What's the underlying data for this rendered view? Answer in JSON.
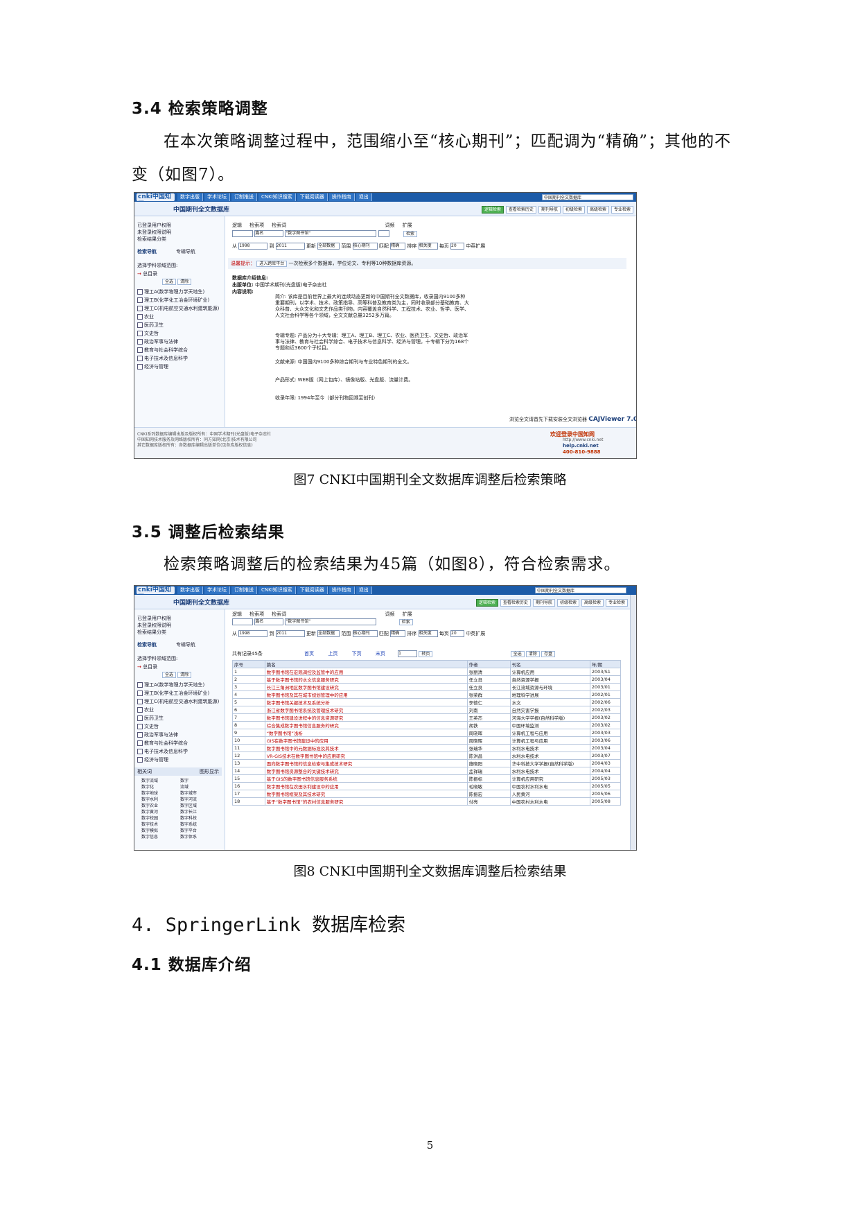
{
  "section_3_4": {
    "heading": "3.4 检索策略调整",
    "paragraph": "在本次策略调整过程中，范围缩小至“核心期刊”；匹配调为“精确”；其他的不变（如图7）。"
  },
  "figure7": {
    "caption": "图7 CNKI中国期刊全文数据库调整后检索策略",
    "logo": "cnki中国知网",
    "nav_tabs": [
      "数字出版",
      "学术论坛",
      "学术论坛",
      "订制推送",
      "CNKI知识搜索",
      "下载阅读器",
      "操作指南",
      "退出"
    ],
    "db_select": "中国期刊全文数据库",
    "db_title": "中国期刊全文数据库",
    "tools": [
      "逻辑检索",
      "查看检索历史",
      "期刊导航",
      "初级检索",
      "高级检索",
      "专业检索"
    ],
    "left_items": [
      "已登录用户权限",
      "未登录权限说明",
      "检索结果分类",
      "检索导航",
      "专辑导航",
      "选择学科领域范围:",
      "总目录",
      "全选",
      "清除",
      "理工A(数学物理力学天地生)",
      "理工B(化学化工冶金环境矿业)",
      "理工C(机电航空交通水利建筑能源)",
      "农业",
      "医药卫生",
      "文史哲",
      "政治军事与法律",
      "教育与社会科学综合",
      "电子技术及信息科学",
      "经济与管理"
    ],
    "fields_header": [
      "逻辑",
      "检索项",
      "检索词",
      "词频",
      "扩展"
    ],
    "field_values": [
      "篇名",
      "\"数字图书馆\"",
      "检索"
    ],
    "range_row": [
      "从",
      "1998",
      "到",
      "2011",
      "更新",
      "全部数据",
      "范围",
      "核心期刊",
      "匹配",
      "精确",
      "排序",
      "相关度",
      "每页",
      "20",
      "中英扩展"
    ],
    "hint_label": "温馨提示：",
    "hint_button": "进入跨库平台",
    "hint_text": "一次检索多个数据库，学位论文、专利等10种数据库资源。",
    "intro_title": "数据库介绍信息:",
    "publisher_label": "出版单位:",
    "publisher": "中国学术期刊(光盘版)电子杂志社",
    "content_label": "内容说明:",
    "desc_1_label": "简介:",
    "desc_1": "该库是目前世界上最大的连续动态更新的中国期刊全文数据库，收录国内9100多种重要期刊，以学术、技术、政策指导、高等科普及教育类为主，同时收录部分基础教育、大众科普、大众文化和文艺作品类刊物，内容覆盖自然科学、工程技术、农业、哲学、医学、人文社会科学等各个领域，全文文献总量3252多万篇。",
    "desc_2_label": "专辑专题:",
    "desc_2": "产品分为十大专辑：理工A、理工B、理工C、农业、医药卫生、文史哲、政治军事与法律、教育与社会科学综合、电子技术与信息科学、经济与管理。十专辑下分为168个专题和近3600个子栏目。",
    "desc_3_label": "文献来源:",
    "desc_3": "中国国内9100多种综合期刊与专业特色期刊的全文。",
    "desc_4_label": "产品形式:",
    "desc_4": "WEB版（网上包库）、镜像站版、光盘版、流量计费。",
    "desc_5_label": "收录年限:",
    "desc_5": "1994年至今（部分刊物回溯至创刊）",
    "cajviewer": "CAJViewer 7.0",
    "cajviewer_note": "浏览全文请首先下载安装全文浏览器",
    "footer_lines": [
      "CNKI系列数据库编辑出版及版权所有：中国学术期刊(光盘版)电子杂志社",
      "中国知网技术服务及网络版权所有：同方知网(北京)技术有限公司",
      "其它数据库版权所有：各数据库编辑出版单位(见各库版权信息)"
    ],
    "welcome": "欢迎登录中国知网",
    "welcome_url": "http://www.cnki.net",
    "help": "help.cnki.net",
    "hotline": "400-810-9888"
  },
  "section_3_5": {
    "heading": "3.5 调整后检索结果",
    "paragraph": "检索策略调整后的检索结果为45篇（如图8），符合检索需求。"
  },
  "figure8": {
    "caption": "图8 CNKI中国期刊全文数据库调整后检索结果",
    "db_select": "中国期刊全文数据库",
    "db_title": "中国期刊全文数据库",
    "results_count": "共有记录45条",
    "pager": [
      "首页",
      "上页",
      "下页",
      "末页",
      "1",
      "转页"
    ],
    "actions": [
      "全选",
      "清除",
      "存盘"
    ],
    "columns": [
      "序号",
      "篇名",
      "作者",
      "刊名",
      "年/期"
    ],
    "rows": [
      [
        "1",
        "数字图书馆在宏观调控及监管中的应用",
        "张丽清",
        "计算机应用",
        "2003/S1"
      ],
      [
        "2",
        "基于数字图书馆的水文信息服务研究",
        "任立良",
        "自然资源学报",
        "2003/04"
      ],
      [
        "3",
        "长江三角洲地区数字图书馆建设研究",
        "任立良",
        "长江流域资源与环境",
        "2003/01"
      ],
      [
        "4",
        "数字图书馆及其在城市规划管理中的应用",
        "张荣群",
        "地理科学进展",
        "2002/01"
      ],
      [
        "5",
        "数字图书馆关键技术及系统分析",
        "李德仁",
        "水文",
        "2002/06"
      ],
      [
        "6",
        "浙江省数字图书馆系统及管理技术研究",
        "刘南",
        "自然灾害学报",
        "2002/03"
      ],
      [
        "7",
        "数字图书馆建设进程中的信息资源研究",
        "王英杰",
        "河海大学学报(自然科学版)",
        "2003/02"
      ],
      [
        "8",
        "综合集成数字图书馆信息服务的研究",
        "胡铁",
        "中国环境监测",
        "2003/02"
      ],
      [
        "9",
        "“数字图书馆”浅析",
        "周晓晖",
        "计算机工程与应用",
        "2003/03"
      ],
      [
        "10",
        "GIS在数字图书馆建设中的应用",
        "周晓晖",
        "计算机工程与应用",
        "2003/06"
      ],
      [
        "11",
        "数字图书馆中的元数据标准及其技术",
        "张瑞华",
        "水利水电技术",
        "2003/04"
      ],
      [
        "12",
        "VR-GIS技术在数字图书馆中的应用研究",
        "陈洪昌",
        "水利水电技术",
        "2003/07"
      ],
      [
        "13",
        "面向数字图书馆的信息检索与集成技术研究",
        "施晓阳",
        "华中科技大学学报(自然科学版)",
        "2004/03"
      ],
      [
        "14",
        "数字图书馆资源整合的关键技术研究",
        "孟祥瑞",
        "水利水电技术",
        "2004/04"
      ],
      [
        "15",
        "基于GIS的数字图书馆信息服务系统",
        "陈振标",
        "计算机应用研究",
        "2005/03"
      ],
      [
        "16",
        "数字图书馆在农田水利建设中的应用",
        "毛晓敏",
        "中国农村水利水电",
        "2005/05"
      ],
      [
        "17",
        "数字图书馆框架及其技术研究",
        "陈振宏",
        "人民黄河",
        "2005/06"
      ],
      [
        "18",
        "基于“数字图书馆”的农村信息服务研究",
        "付亮",
        "中国农村水利水电",
        "2005/08"
      ]
    ],
    "left_extra_header": [
      "相关词",
      "图形显示"
    ],
    "related_terms": [
      "数字流域",
      "数字",
      "数字化",
      "流域",
      "数字地球",
      "数字城市",
      "数字水利",
      "数字河流",
      "数字农业",
      "数字区域",
      "数字黄河",
      "数字长江",
      "数字校园",
      "数字科技",
      "数字技术",
      "数字系统",
      "数字模拟",
      "数字平台",
      "数字信息",
      "数字体系"
    ]
  },
  "section_4": {
    "heading": "4. SpringerLink 数据库检索"
  },
  "section_4_1": {
    "heading": "4.1 数据库介绍"
  },
  "page_number": "5"
}
